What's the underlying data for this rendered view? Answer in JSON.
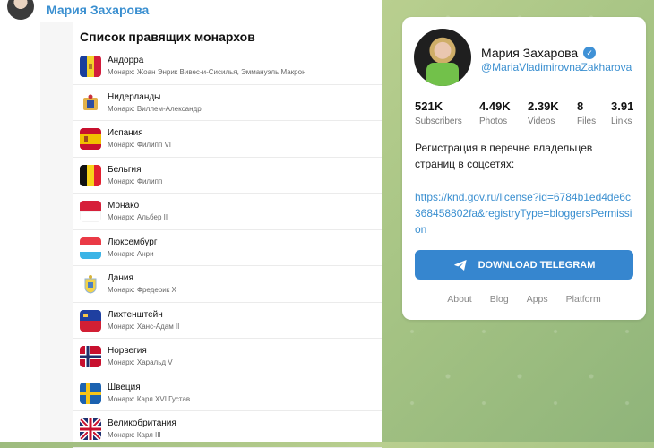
{
  "post": {
    "author": "Мария Захарова",
    "doc_title": "Список правящих монархов",
    "rows": [
      {
        "country": "Андорра",
        "monarch": "Монарх: Жоан Энрик Вивес-и-Сисилья, Эммануэль Макрон",
        "flag": "andorra-flag-icon"
      },
      {
        "country": "Нидерланды",
        "monarch": "Монарх: Виллем-Александр",
        "flag": "netherlands-coat-of-arms-icon"
      },
      {
        "country": "Испания",
        "monarch": "Монарх: Филипп VI",
        "flag": "spain-flag-icon"
      },
      {
        "country": "Бельгия",
        "monarch": "Монарх: Филипп",
        "flag": "belgium-flag-icon"
      },
      {
        "country": "Монако",
        "monarch": "Монарх: Альбер II",
        "flag": "monaco-flag-icon"
      },
      {
        "country": "Люксембург",
        "monarch": "Монарх: Анри",
        "flag": "luxembourg-flag-icon"
      },
      {
        "country": "Дания",
        "monarch": "Монарх: Фредерик X",
        "flag": "denmark-coat-of-arms-icon"
      },
      {
        "country": "Лихтенштейн",
        "monarch": "Монарх: Ханс-Адам II",
        "flag": "liechtenstein-flag-icon"
      },
      {
        "country": "Норвегия",
        "monarch": "Монарх: Харальд V",
        "flag": "norway-flag-icon"
      },
      {
        "country": "Швеция",
        "monarch": "Монарх: Карл XVI Густав",
        "flag": "sweden-flag-icon"
      },
      {
        "country": "Великобритания",
        "monarch": "Монарх: Карл III",
        "flag": "uk-flag-icon"
      }
    ]
  },
  "channel": {
    "name": "Мария Захарова",
    "handle": "@MariaVladimirovnaZakharova",
    "stats": [
      {
        "value": "521K",
        "label": "Subscribers"
      },
      {
        "value": "4.49K",
        "label": "Photos"
      },
      {
        "value": "2.39K",
        "label": "Videos"
      },
      {
        "value": "8",
        "label": "Files"
      },
      {
        "value": "3.91",
        "label": "Links"
      }
    ],
    "description": "Регистрация в перечне владельцев страниц в соцсетях:",
    "link": "https://knd.gov.ru/license?id=6784b1ed4de6c368458802fa&registryType=bloggersPermission",
    "download_label": "DOWNLOAD TELEGRAM",
    "footer": [
      "About",
      "Blog",
      "Apps",
      "Platform"
    ]
  },
  "colors": {
    "accent": "#3a8fd0",
    "button": "#3686cf",
    "background": "#a8c585"
  }
}
